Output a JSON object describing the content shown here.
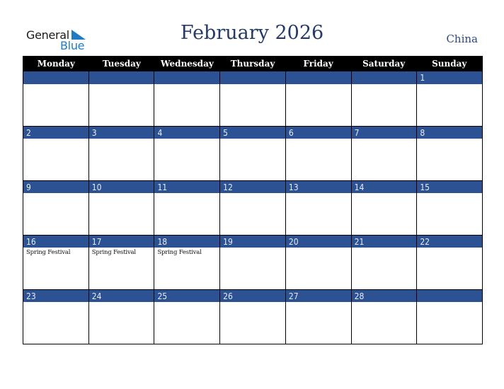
{
  "logo": {
    "line1": "General",
    "line2": "Blue"
  },
  "header": {
    "title": "February 2026",
    "country": "China"
  },
  "colors": {
    "accent": "#2c5294",
    "title": "#233b66",
    "logo_blue": "#1e7bc4",
    "header_bg": "#000000"
  },
  "weekdays": [
    "Monday",
    "Tuesday",
    "Wednesday",
    "Thursday",
    "Friday",
    "Saturday",
    "Sunday"
  ],
  "weeks": [
    {
      "days": [
        {
          "num": "",
          "event": ""
        },
        {
          "num": "",
          "event": ""
        },
        {
          "num": "",
          "event": ""
        },
        {
          "num": "",
          "event": ""
        },
        {
          "num": "",
          "event": ""
        },
        {
          "num": "",
          "event": ""
        },
        {
          "num": "1",
          "event": ""
        }
      ]
    },
    {
      "days": [
        {
          "num": "2",
          "event": ""
        },
        {
          "num": "3",
          "event": ""
        },
        {
          "num": "4",
          "event": ""
        },
        {
          "num": "5",
          "event": ""
        },
        {
          "num": "6",
          "event": ""
        },
        {
          "num": "7",
          "event": ""
        },
        {
          "num": "8",
          "event": ""
        }
      ]
    },
    {
      "days": [
        {
          "num": "9",
          "event": ""
        },
        {
          "num": "10",
          "event": ""
        },
        {
          "num": "11",
          "event": ""
        },
        {
          "num": "12",
          "event": ""
        },
        {
          "num": "13",
          "event": ""
        },
        {
          "num": "14",
          "event": ""
        },
        {
          "num": "15",
          "event": ""
        }
      ]
    },
    {
      "days": [
        {
          "num": "16",
          "event": "Spring Festival"
        },
        {
          "num": "17",
          "event": "Spring Festival"
        },
        {
          "num": "18",
          "event": "Spring Festival"
        },
        {
          "num": "19",
          "event": ""
        },
        {
          "num": "20",
          "event": ""
        },
        {
          "num": "21",
          "event": ""
        },
        {
          "num": "22",
          "event": ""
        }
      ]
    },
    {
      "days": [
        {
          "num": "23",
          "event": ""
        },
        {
          "num": "24",
          "event": ""
        },
        {
          "num": "25",
          "event": ""
        },
        {
          "num": "26",
          "event": ""
        },
        {
          "num": "27",
          "event": ""
        },
        {
          "num": "28",
          "event": ""
        },
        {
          "num": "",
          "event": ""
        }
      ]
    }
  ]
}
